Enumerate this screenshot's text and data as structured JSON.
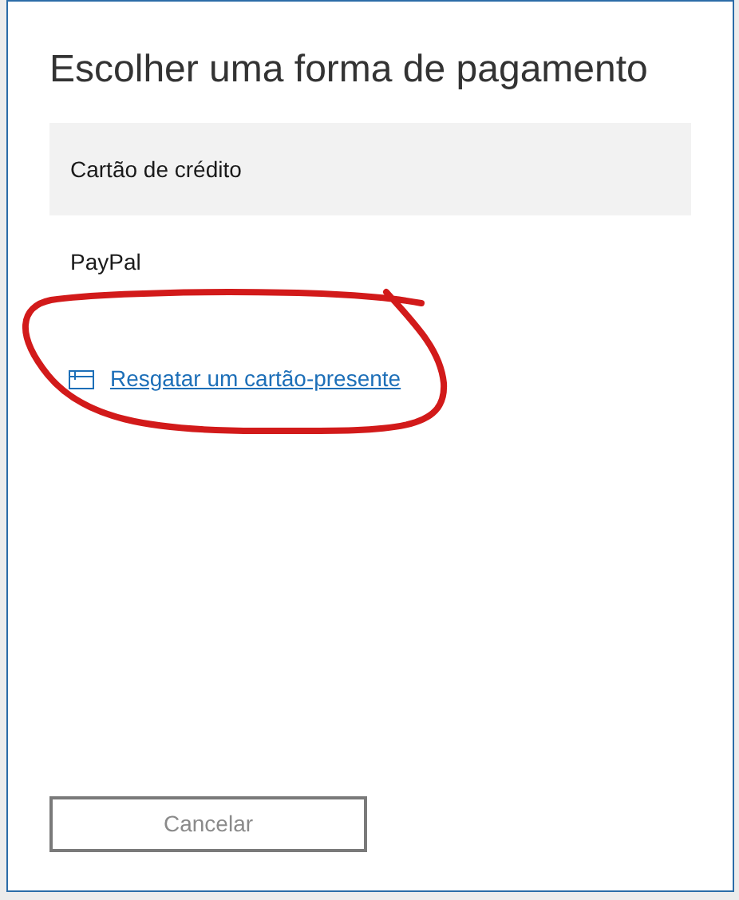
{
  "dialog": {
    "title": "Escolher uma forma de pagamento",
    "options": [
      {
        "label": "Cartão de crédito",
        "selected": true
      },
      {
        "label": "PayPal",
        "selected": false
      }
    ],
    "link": "Resgatar um cartão-presente",
    "buttons": [
      "Cancelar"
    ]
  }
}
